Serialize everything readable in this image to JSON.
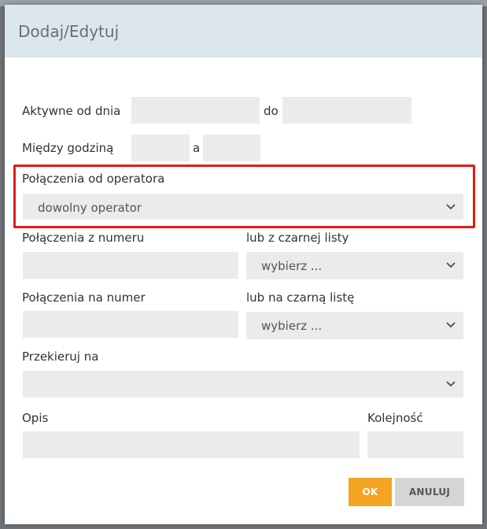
{
  "dialog": {
    "title": "Dodaj/Edytuj"
  },
  "form": {
    "active_from_label": "Aktywne od dnia",
    "active_to_label": "do",
    "between_hours_label": "Między godziną",
    "hours_and_label": "a",
    "operator_label": "Połączenia od operatora",
    "operator_value": "dowolny operator",
    "from_number_label": "Połączenia z numeru",
    "from_blacklist_label": "lub z czarnej listy",
    "from_blacklist_value": "wybierz ...",
    "to_number_label": "Połączenia na numer",
    "to_blacklist_label": "lub na czarną listę",
    "to_blacklist_value": "wybierz ...",
    "redirect_label": "Przekieruj na",
    "redirect_value": "",
    "description_label": "Opis",
    "order_label": "Kolejność"
  },
  "buttons": {
    "ok": "OK",
    "cancel": "ANULUJ"
  },
  "colors": {
    "highlight": "#e11b1b",
    "ok_button": "#f4a423",
    "header": "#dbe6ee"
  }
}
